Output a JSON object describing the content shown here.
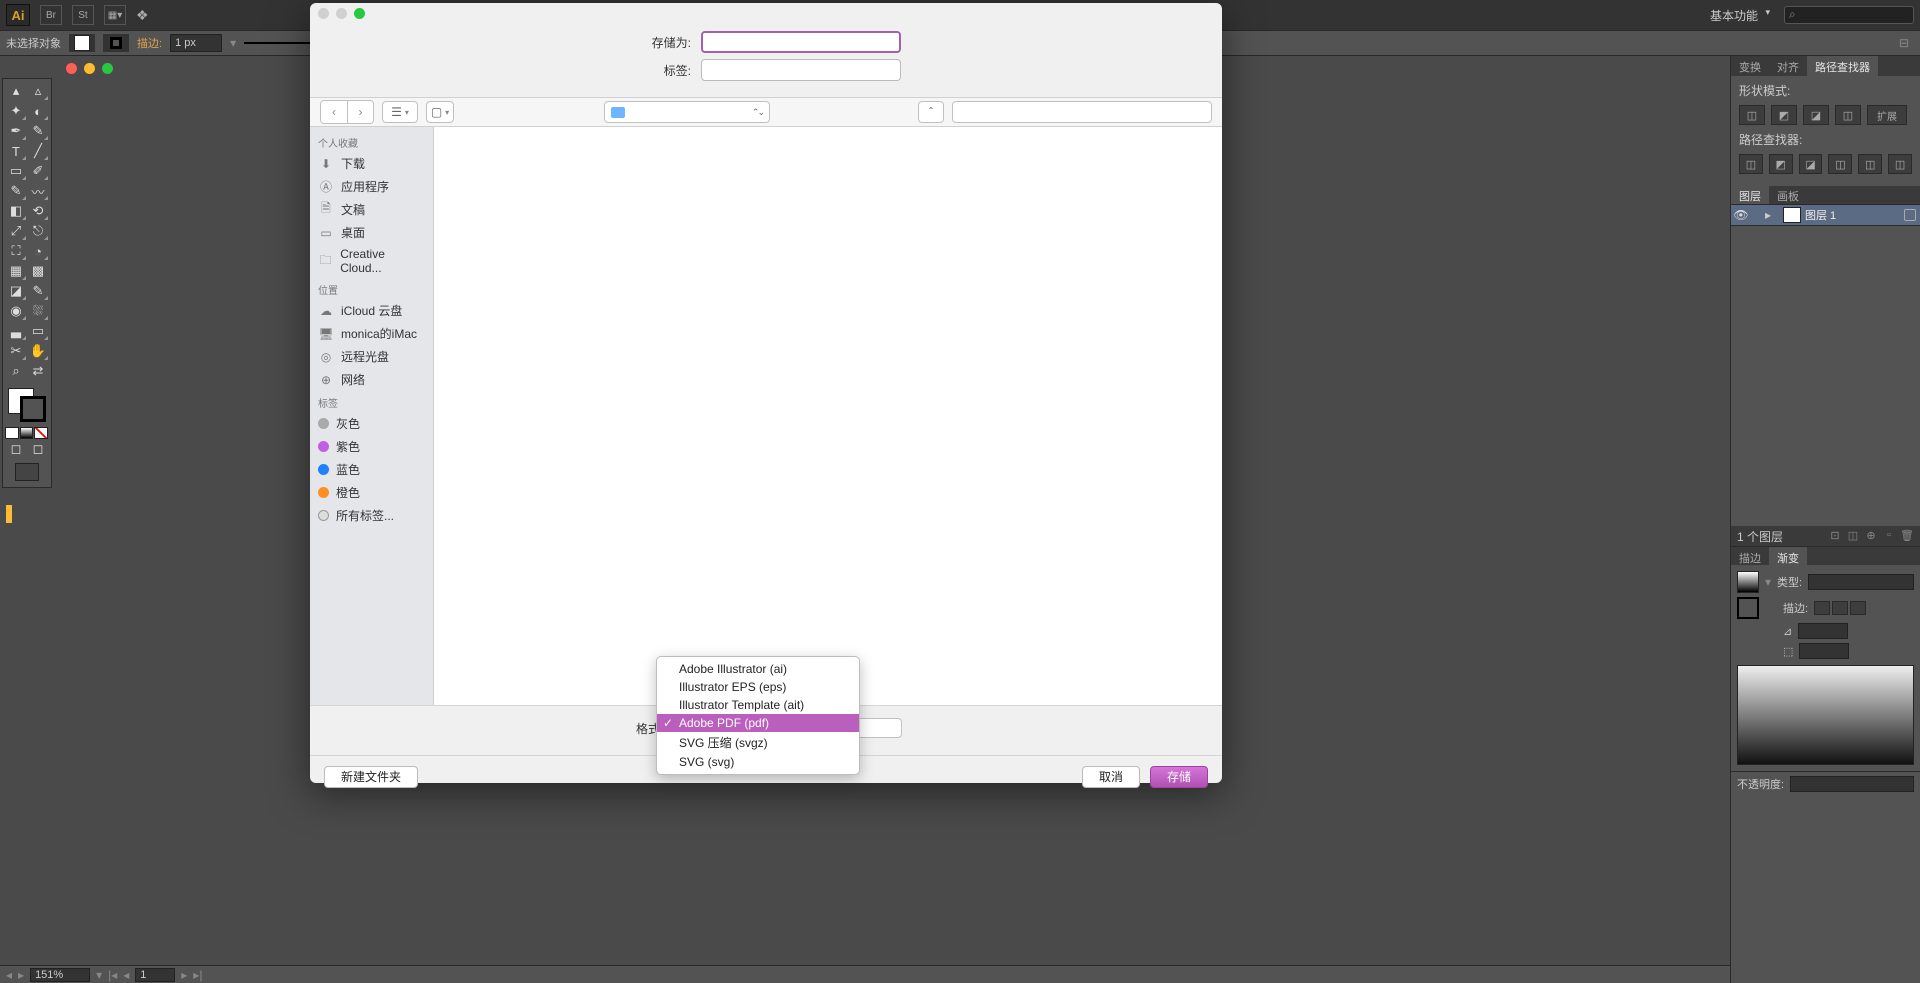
{
  "menubar": {
    "logo": "Ai",
    "workspace": "基本功能"
  },
  "controlbar": {
    "no_selection": "未选择对象",
    "stroke_label": "描边:",
    "stroke_value": "1 px"
  },
  "statusbar": {
    "zoom": "151%",
    "artboard": "1"
  },
  "right_panel": {
    "tabs": {
      "transform": "变换",
      "align": "对齐",
      "pathfinder": "路径查找器"
    },
    "shape_modes": "形状模式:",
    "pathfinder_label": "路径查找器:",
    "layers_tab": "图层",
    "artboards_tab": "画板",
    "layer1": "图层 1",
    "layer_count": "1 个图层",
    "stroke_tab": "描边",
    "gradient_tab": "渐变",
    "type_label": "类型:",
    "stroke_label2": "描边:",
    "opacity_label": "不透明度:"
  },
  "dialog": {
    "save_as_label": "存储为:",
    "save_as_value": "",
    "tags_label": "标签:",
    "tags_value": "",
    "search_placeholder": "",
    "location": "",
    "sidebar": {
      "favorites": "个人收藏",
      "downloads": "下载",
      "applications": "应用程序",
      "documents": "文稿",
      "desktop": "桌面",
      "creative_cloud": "Creative Cloud...",
      "locations": "位置",
      "icloud": "iCloud 云盘",
      "imac": "monica的iMac",
      "remote_disc": "远程光盘",
      "network": "网络",
      "tags": "标签",
      "tag_gray": "灰色",
      "tag_purple": "紫色",
      "tag_blue": "蓝色",
      "tag_orange": "橙色",
      "tag_all": "所有标签..."
    },
    "format_label": "格式",
    "format_options": {
      "ai": "Adobe Illustrator (ai)",
      "eps": "Illustrator EPS (eps)",
      "ait": "Illustrator Template (ait)",
      "pdf": "Adobe PDF (pdf)",
      "svgz": "SVG 压缩 (svgz)",
      "svg": "SVG (svg)"
    },
    "new_folder": "新建文件夹",
    "cancel": "取消",
    "save": "存储"
  }
}
